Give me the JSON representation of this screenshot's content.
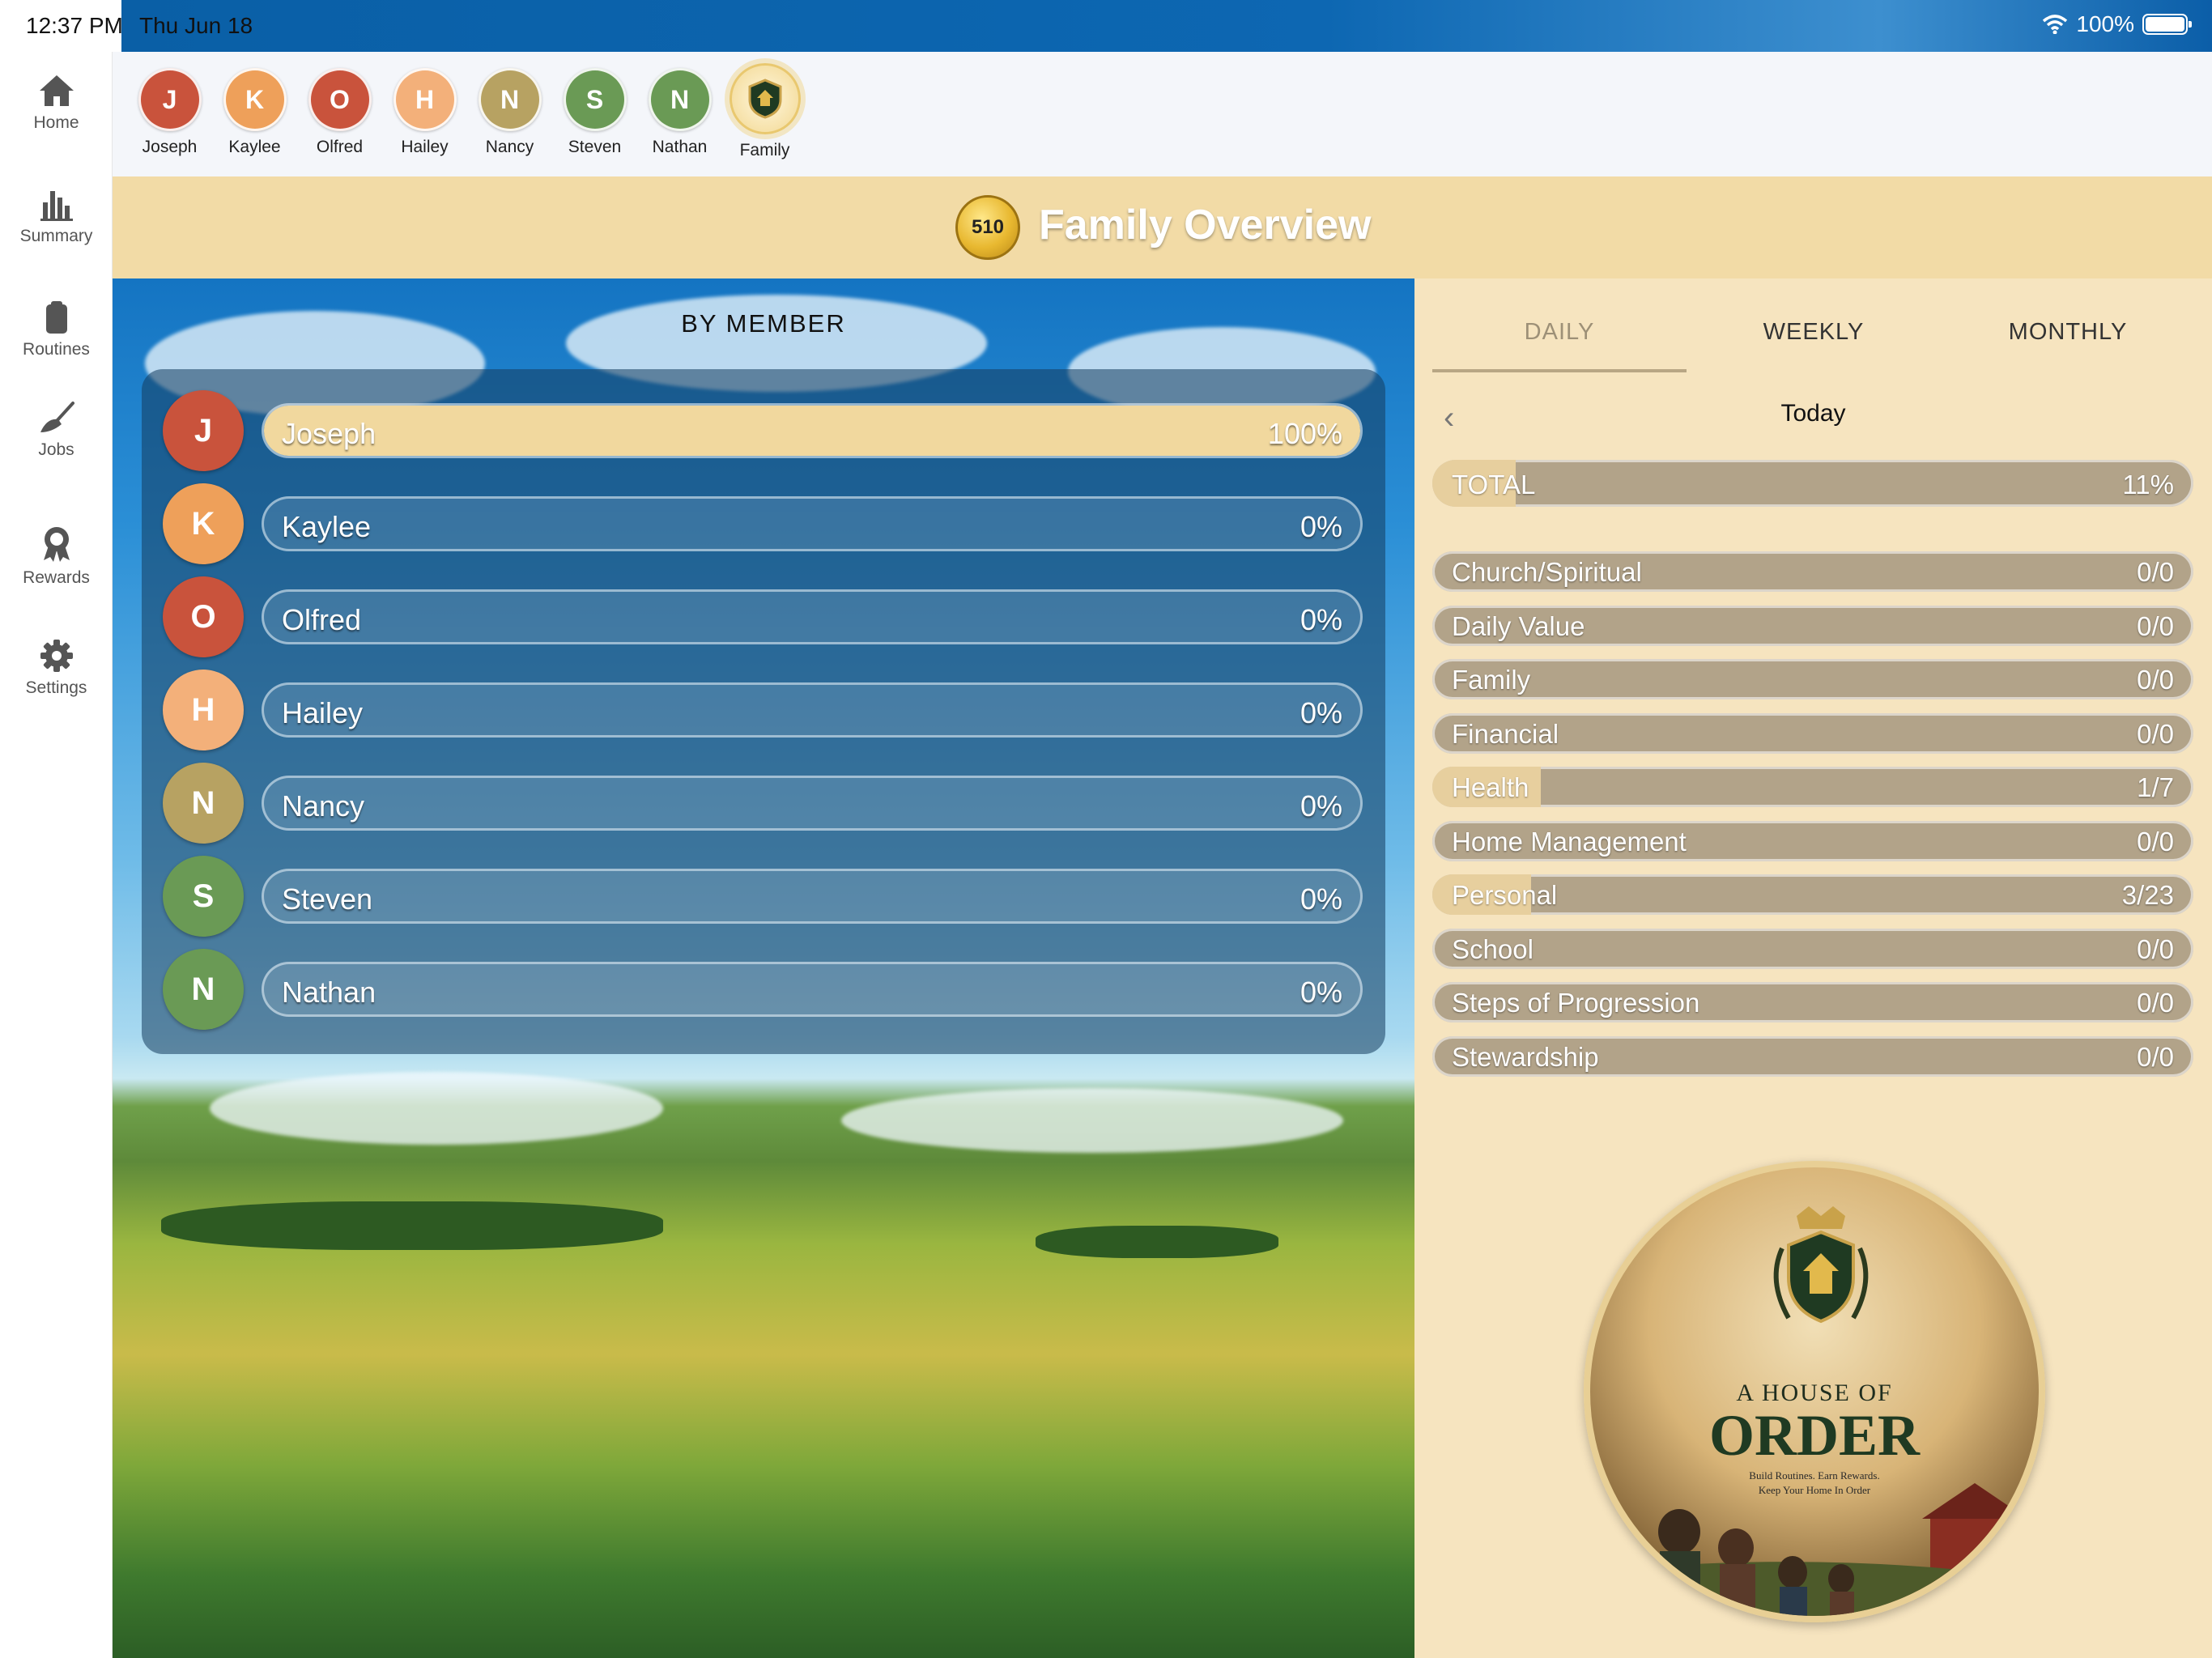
{
  "status_bar": {
    "time": "12:37 PM",
    "date": "Thu Jun 18",
    "battery": "100%"
  },
  "sidebar": {
    "items": [
      {
        "label": "Home",
        "icon": "home-icon"
      },
      {
        "label": "Summary",
        "icon": "bar-chart-icon"
      },
      {
        "label": "Routines",
        "icon": "clipboard-icon"
      },
      {
        "label": "Jobs",
        "icon": "broom-icon"
      },
      {
        "label": "Rewards",
        "icon": "ribbon-icon"
      },
      {
        "label": "Settings",
        "icon": "gear-icon"
      }
    ]
  },
  "members": [
    {
      "initial": "J",
      "name": "Joseph",
      "color": "#c9533c"
    },
    {
      "initial": "K",
      "name": "Kaylee",
      "color": "#eea05a"
    },
    {
      "initial": "O",
      "name": "Olfred",
      "color": "#c9533c"
    },
    {
      "initial": "H",
      "name": "Hailey",
      "color": "#f3b07a"
    },
    {
      "initial": "N",
      "name": "Nancy",
      "color": "#b7a262"
    },
    {
      "initial": "S",
      "name": "Steven",
      "color": "#6a9a55"
    },
    {
      "initial": "N",
      "name": "Nathan",
      "color": "#6a9a55"
    },
    {
      "initial": "",
      "name": "Family",
      "color": "#f2dba6"
    }
  ],
  "header": {
    "points": "510",
    "title": "Family Overview"
  },
  "by_member": {
    "heading": "BY MEMBER",
    "rows": [
      {
        "initial": "J",
        "name": "Joseph",
        "percent": "100%",
        "progress": 1.0
      },
      {
        "initial": "K",
        "name": "Kaylee",
        "percent": "0%",
        "progress": 0
      },
      {
        "initial": "O",
        "name": "Olfred",
        "percent": "0%",
        "progress": 0
      },
      {
        "initial": "H",
        "name": "Hailey",
        "percent": "0%",
        "progress": 0
      },
      {
        "initial": "N",
        "name": "Nancy",
        "percent": "0%",
        "progress": 0
      },
      {
        "initial": "S",
        "name": "Steven",
        "percent": "0%",
        "progress": 0
      },
      {
        "initial": "N",
        "name": "Nathan",
        "percent": "0%",
        "progress": 0
      }
    ]
  },
  "tabs": [
    "DAILY",
    "WEEKLY",
    "MONTHLY"
  ],
  "active_tab": "DAILY",
  "period": {
    "label": "Today"
  },
  "total": {
    "label": "TOTAL",
    "value": "11%",
    "progress": 0.11
  },
  "categories": [
    {
      "name": "Church/Spiritual",
      "value": "0/0",
      "progress": 0
    },
    {
      "name": "Daily Value",
      "value": "0/0",
      "progress": 0
    },
    {
      "name": "Family",
      "value": "0/0",
      "progress": 0
    },
    {
      "name": "Financial",
      "value": "0/0",
      "progress": 0
    },
    {
      "name": "Health",
      "value": "1/7",
      "progress": 0.143
    },
    {
      "name": "Home Management",
      "value": "0/0",
      "progress": 0
    },
    {
      "name": "Personal",
      "value": "3/23",
      "progress": 0.13
    },
    {
      "name": "School",
      "value": "0/0",
      "progress": 0
    },
    {
      "name": "Steps of Progression",
      "value": "0/0",
      "progress": 0
    },
    {
      "name": "Stewardship",
      "value": "0/0",
      "progress": 0
    }
  ],
  "logo": {
    "line1": "A HOUSE OF",
    "line2": "ORDER",
    "line3": "Build Routines. Earn Rewards.",
    "line4": "Keep Your Home In Order"
  }
}
